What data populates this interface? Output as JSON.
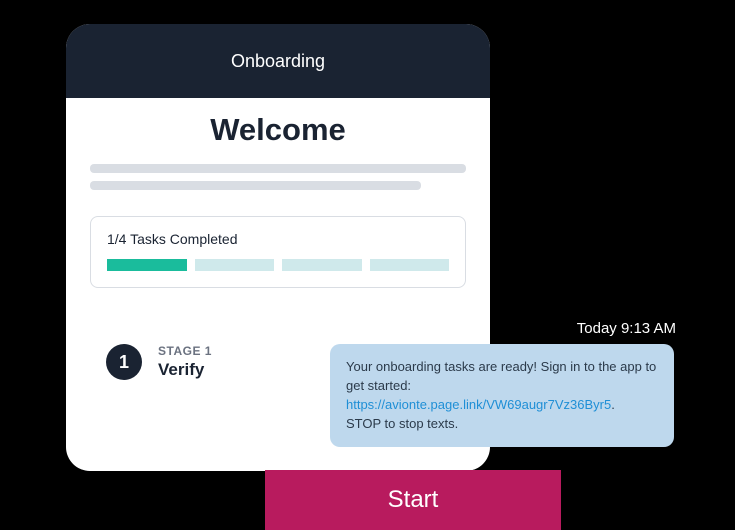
{
  "header": {
    "title": "Onboarding"
  },
  "main": {
    "welcome_title": "Welcome",
    "progress_text": "1/4 Tasks Completed",
    "progress_completed": 1,
    "progress_total": 4,
    "stage": {
      "number": "1",
      "label": "STAGE 1",
      "name": "Verify"
    }
  },
  "notification": {
    "timestamp": "Today 9:13 AM",
    "body_pre": "Your  onboarding tasks are ready! Sign in to the app to get started:",
    "link": "https://avionte.page.link/VW69augr7Vz36Byr5",
    "body_post": "STOP to stop texts."
  },
  "cta": {
    "start_label": "Start"
  }
}
